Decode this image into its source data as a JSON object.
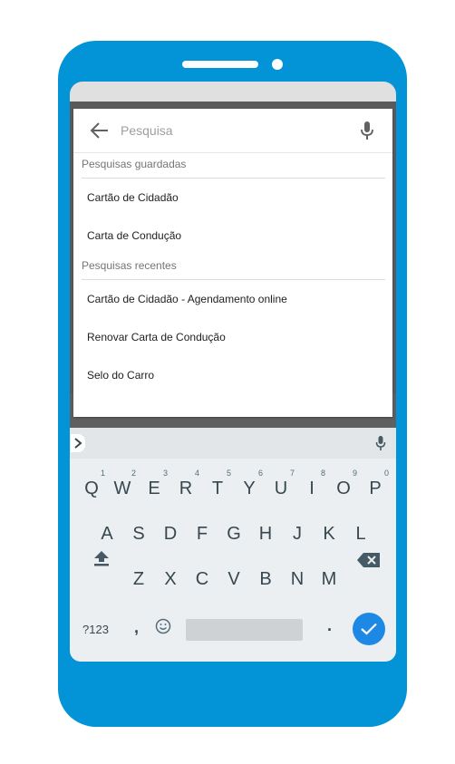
{
  "search": {
    "placeholder": "Pesquisa"
  },
  "saved": {
    "header": "Pesquisas guardadas",
    "items": [
      "Cartão de Cidadão",
      "Carta de Condução"
    ]
  },
  "recent": {
    "header": "Pesquisas recentes",
    "items": [
      "Cartão de Cidadão - Agendamento online",
      "Renovar Carta de Condução",
      "Selo do Carro"
    ]
  },
  "keyboard": {
    "row1": [
      "Q",
      "W",
      "E",
      "R",
      "T",
      "Y",
      "U",
      "I",
      "O",
      "P"
    ],
    "row1_hints": [
      "1",
      "2",
      "3",
      "4",
      "5",
      "6",
      "7",
      "8",
      "9",
      "0"
    ],
    "row2": [
      "A",
      "S",
      "D",
      "F",
      "G",
      "H",
      "J",
      "K",
      "L"
    ],
    "row3": [
      "Z",
      "X",
      "C",
      "V",
      "B",
      "N",
      "M"
    ],
    "symbols_label": "?123",
    "comma": ",",
    "period": "."
  },
  "colors": {
    "phone_body": "#0294d6",
    "enter_button": "#1e88e5",
    "keyboard_bg": "#eceff1"
  },
  "icons": [
    "back-arrow-icon",
    "microphone-icon",
    "chevron-right-icon",
    "shift-icon",
    "backspace-icon",
    "emoji-icon",
    "check-icon"
  ]
}
